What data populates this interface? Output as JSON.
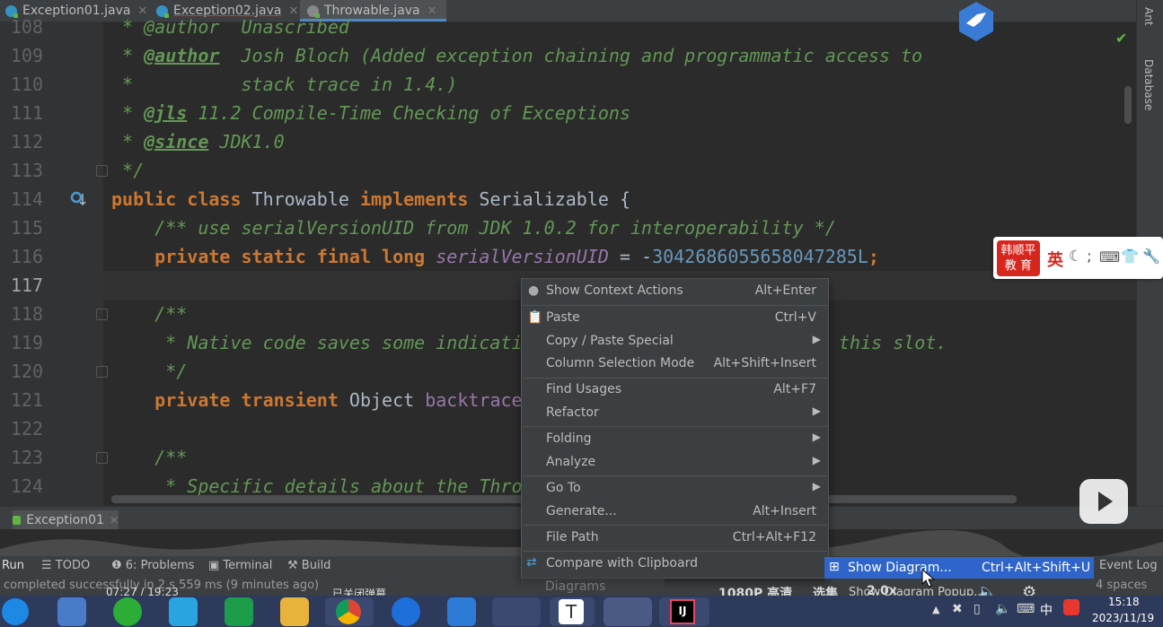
{
  "tabs": [
    {
      "label": "Exception01.java",
      "close": "✕"
    },
    {
      "label": "Exception02.java",
      "close": "✕"
    },
    {
      "label": "Throwable.java",
      "close": "✕"
    }
  ],
  "right_tools": [
    "Ant",
    "Database"
  ],
  "code": {
    "l108": {
      "num": "108",
      "text": " * @author  Unascribed"
    },
    "l109": {
      "num": "109",
      "star": " * ",
      "tag": "@author",
      "rest": "  Josh Bloch (Added exception chaining and programmatic access to"
    },
    "l110": {
      "num": "110",
      "text": " *          stack trace in 1.4.)"
    },
    "l111": {
      "num": "111",
      "star": " * ",
      "tag": "@jls",
      "rest": " 11.2 Compile-Time Checking of Exceptions"
    },
    "l112": {
      "num": "112",
      "star": " * ",
      "tag": "@since",
      "rest": " JDK1.0"
    },
    "l113": {
      "num": "113",
      "text": " */"
    },
    "l114": {
      "num": "114",
      "kw1": "public class ",
      "cls": "Throwable ",
      "kw2": "implements ",
      "iface": "Serializable {"
    },
    "l115": {
      "num": "115",
      "text": "    /** use serialVersionUID from JDK 1.0.2 for interoperability */"
    },
    "l116": {
      "num": "116",
      "kw": "    private static final long ",
      "field": "serialVersionUID",
      "eq": " = -",
      "value": "3042686055658047285L",
      "semi": ";"
    },
    "l117": {
      "num": "117"
    },
    "l118": {
      "num": "118",
      "text": "    /**"
    },
    "l119": {
      "num": "119",
      "text": "     * Native code saves some indicati",
      "tail": "this slot."
    },
    "l120": {
      "num": "120",
      "text": "     */"
    },
    "l121": {
      "num": "121",
      "kw": "    private transient ",
      "type": "Object ",
      "field": "backtrace"
    },
    "l122": {
      "num": "122"
    },
    "l123": {
      "num": "123",
      "text": "    /**"
    },
    "l124": {
      "num": "124",
      "text": "     * Specific details about the Thro"
    }
  },
  "context_menu": {
    "items": [
      {
        "label": "Show Context Actions",
        "shortcut": "Alt+Enter",
        "icon": "bulb-icon"
      },
      {
        "label": "Paste",
        "shortcut": "Ctrl+V",
        "icon": "clipboard-icon"
      },
      {
        "label": "Copy / Paste Special",
        "submenu": "▶"
      },
      {
        "label": "Column Selection Mode",
        "shortcut": "Alt+Shift+Insert"
      },
      {
        "label": "Find Usages",
        "shortcut": "Alt+F7"
      },
      {
        "label": "Refactor",
        "submenu": "▶"
      },
      {
        "label": "Folding",
        "submenu": "▶"
      },
      {
        "label": "Analyze",
        "submenu": "▶"
      },
      {
        "label": "Go To",
        "submenu": "▶"
      },
      {
        "label": "Generate...",
        "shortcut": "Alt+Insert"
      },
      {
        "label": "File Path",
        "shortcut": "Ctrl+Alt+F12"
      },
      {
        "label": "Compare with Clipboard",
        "icon": "compare-icon"
      },
      {
        "label": "Diagrams"
      }
    ]
  },
  "submenu_tip": {
    "label": "Show Diagram...",
    "shortcut": "Ctrl+Alt+Shift+U",
    "below": "Show Diagram Popup..."
  },
  "run_tab": {
    "label": "Exception01",
    "close": "✕"
  },
  "tool_windows": [
    "Run",
    "TODO",
    "6: Problems",
    "Terminal",
    "Build"
  ],
  "event_log": "Event Log",
  "status": {
    "message": "completed successfully in 2 s 559 ms (9 minutes ago)",
    "indent": "4 spaces"
  },
  "ime": {
    "brand_line1": "韩顺平",
    "brand_line2": "教 育",
    "lang": "英"
  },
  "video": {
    "time": "07:27 / 19:23",
    "quality": "1080P 高清",
    "chapters": "选集",
    "speed": "2.0x",
    "danmaku": "已关闭弹幕"
  },
  "tray": {
    "time": "15:18",
    "date": "2023/11/19",
    "lang": "中"
  },
  "colors": {
    "keyword": "#cc7832",
    "comment": "#629755",
    "field": "#9876aa",
    "number": "#6897bb",
    "menu_bg": "#3c3f41",
    "highlight": "#2f65ca"
  }
}
